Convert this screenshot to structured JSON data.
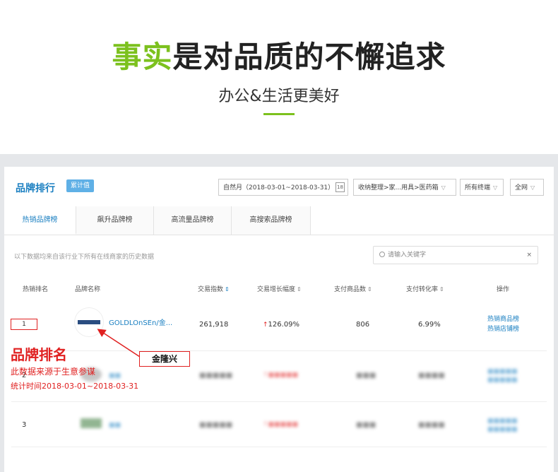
{
  "hero": {
    "title_accent": "事实",
    "title_rest": "是对品质的不懈追求",
    "subtitle": "办公&生活更美好",
    "accent_color": "#7cc11e"
  },
  "panel": {
    "title": "品牌排行",
    "tag": "累计值",
    "date_range": "自然月（2018-03-01~2018-03-31）",
    "category": "收纳整理>家...用具>医药箱",
    "terminal": "所有终端",
    "scope": "全网"
  },
  "tabs": [
    "热销品牌榜",
    "飙升品牌榜",
    "高流量品牌榜",
    "高搜索品牌榜"
  ],
  "note": "以下数据均来自该行业下所有在线商家的历史数据",
  "search": {
    "placeholder": "请输入关键字",
    "clear": "×"
  },
  "table": {
    "headers": [
      "热销排名",
      "品牌名称",
      "交易指数",
      "交易增长幅度",
      "支付商品数",
      "支付转化率",
      "操作"
    ],
    "rows": [
      {
        "rank": "1",
        "brand": "GOLDLOnSEn/金...",
        "trade_index": "261,918",
        "growth": "126.09%",
        "items": "806",
        "conversion": "6.99%",
        "actions": [
          "热销商品榜",
          "热销店铺榜"
        ]
      },
      {
        "rank": "2"
      },
      {
        "rank": "3"
      }
    ]
  },
  "annotation": {
    "title": "品牌排名",
    "source": "此数据来源于生意参谋",
    "time": "统计时间2018-03-01~2018-03-31",
    "callout": "金隆兴",
    "color": "#e02020"
  }
}
